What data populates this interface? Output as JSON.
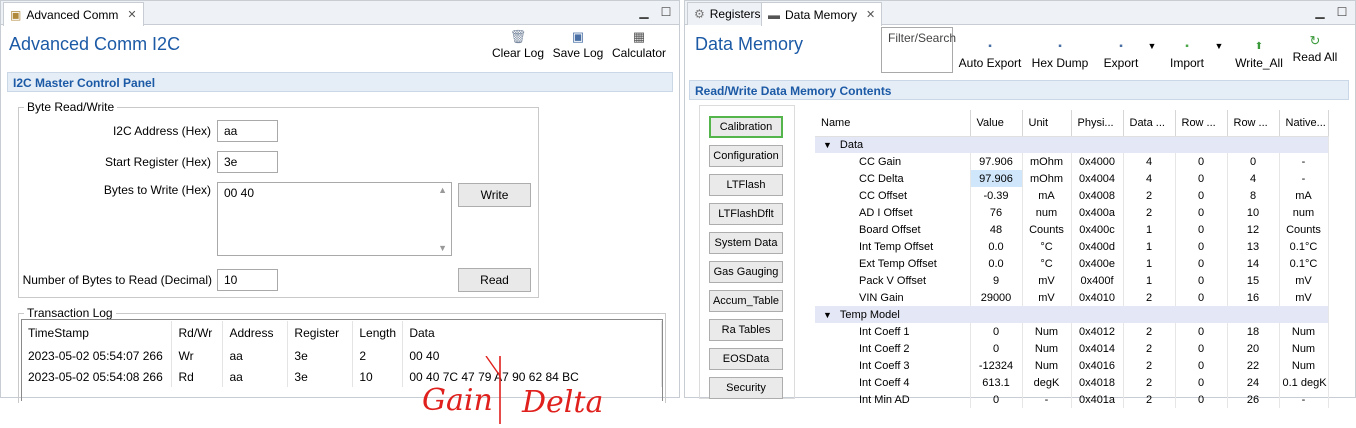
{
  "left": {
    "tab_label": "Advanced Comm",
    "title": "Advanced Comm I2C",
    "toolbar": {
      "clear_log": "Clear Log",
      "save_log": "Save Log",
      "calculator": "Calculator"
    },
    "section_header": "I2C Master Control Panel",
    "byte_rw": {
      "group_title": "Byte Read/Write",
      "i2c_address_label": "I2C Address (Hex)",
      "i2c_address_value": "aa",
      "start_register_label": "Start Register (Hex)",
      "start_register_value": "3e",
      "bytes_to_write_label": "Bytes to Write (Hex)",
      "bytes_to_write_value": "00 40",
      "write_button": "Write",
      "bytes_to_read_label": "Number of Bytes to Read (Decimal)",
      "bytes_to_read_value": "10",
      "read_button": "Read"
    },
    "log": {
      "group_title": "Transaction Log",
      "columns": [
        "TimeStamp",
        "Rd/Wr",
        "Address",
        "Register",
        "Length",
        "Data"
      ],
      "rows": [
        [
          "2023-05-02 05:54:07 266",
          "Wr",
          "aa",
          "3e",
          "2",
          "00 40"
        ],
        [
          "2023-05-02 05:54:08 266",
          "Rd",
          "aa",
          "3e",
          "10",
          "00 40 7C 47 79 A7 90 62 84 BC"
        ]
      ]
    },
    "annotation": {
      "gain": "Gain",
      "delta": "Delta"
    }
  },
  "right": {
    "tabs": [
      "Registers",
      "Data Memory"
    ],
    "title": "Data Memory",
    "filter_placeholder": "Filter/Search",
    "toolbar": {
      "auto_export": "Auto Export",
      "hex_dump": "Hex Dump",
      "export": "Export",
      "import": "Import",
      "write_all": "Write_All",
      "read_all": "Read All"
    },
    "section_header": "Read/Write Data Memory Contents",
    "categories": [
      "Calibration",
      "Configuration",
      "LTFlash",
      "LTFlashDflt",
      "System Data",
      "Gas Gauging",
      "Accum_Table",
      "Ra Tables",
      "EOSData",
      "Security"
    ],
    "table": {
      "columns": [
        "Name",
        "Value",
        "Unit",
        "Physi...",
        "Data ...",
        "Row ...",
        "Row ...",
        "Native..."
      ],
      "groups": [
        {
          "name": "Data",
          "rows": [
            [
              "CC Gain",
              "97.906",
              "mOhm",
              "0x4000",
              "4",
              "0",
              "0",
              "-"
            ],
            [
              "CC Delta",
              "97.906",
              "mOhm",
              "0x4004",
              "4",
              "0",
              "4",
              "-"
            ],
            [
              "CC Offset",
              "-0.39",
              "mA",
              "0x4008",
              "2",
              "0",
              "8",
              "mA"
            ],
            [
              "AD I Offset",
              "76",
              "num",
              "0x400a",
              "2",
              "0",
              "10",
              "num"
            ],
            [
              "Board Offset",
              "48",
              "Counts",
              "0x400c",
              "1",
              "0",
              "12",
              "Counts"
            ],
            [
              "Int Temp Offset",
              "0.0",
              "°C",
              "0x400d",
              "1",
              "0",
              "13",
              "0.1°C"
            ],
            [
              "Ext Temp Offset",
              "0.0",
              "°C",
              "0x400e",
              "1",
              "0",
              "14",
              "0.1°C"
            ],
            [
              "Pack V Offset",
              "9",
              "mV",
              "0x400f",
              "1",
              "0",
              "15",
              "mV"
            ],
            [
              "VIN Gain",
              "29000",
              "mV",
              "0x4010",
              "2",
              "0",
              "16",
              "mV"
            ]
          ]
        },
        {
          "name": "Temp Model",
          "rows": [
            [
              "Int Coeff 1",
              "0",
              "Num",
              "0x4012",
              "2",
              "0",
              "18",
              "Num"
            ],
            [
              "Int Coeff 2",
              "0",
              "Num",
              "0x4014",
              "2",
              "0",
              "20",
              "Num"
            ],
            [
              "Int Coeff 3",
              "-12324",
              "Num",
              "0x4016",
              "2",
              "0",
              "22",
              "Num"
            ],
            [
              "Int Coeff 4",
              "613.1",
              "degK",
              "0x4018",
              "2",
              "0",
              "24",
              "0.1 degK"
            ],
            [
              "Int Min AD",
              "0",
              "-",
              "0x401a",
              "2",
              "0",
              "26",
              "-"
            ]
          ]
        }
      ]
    }
  }
}
